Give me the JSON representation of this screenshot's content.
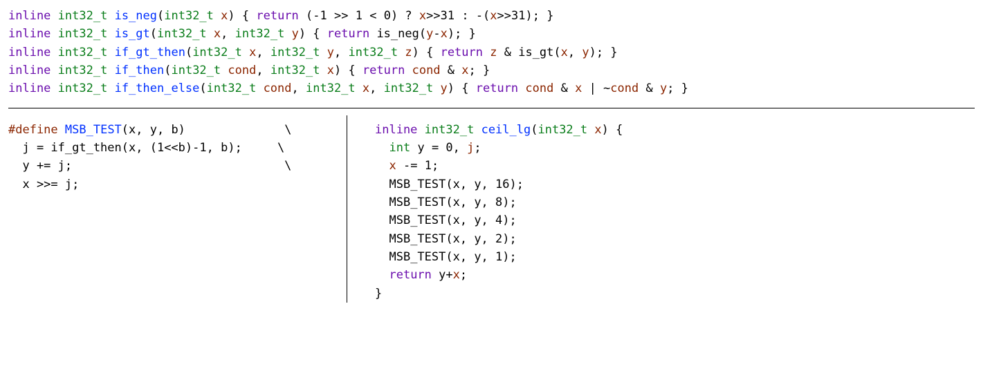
{
  "tokens": {
    "inline": "inline",
    "int32": "int32_t",
    "int": "int",
    "return": "return",
    "define": "#define"
  },
  "top": {
    "is_neg": {
      "name": "is_neg",
      "params": "x",
      "body_pre": "(-",
      "body_num1": "1",
      "body_mid1": " >> ",
      "body_num2": "1",
      "body_mid2": " < ",
      "body_num3": "0",
      "body_mid3": ") ? ",
      "body_var1": "x",
      "body_mid4": ">>",
      "body_num4": "31",
      "body_mid5": " : -(",
      "body_var2": "x",
      "body_mid6": ">>",
      "body_num5": "31",
      "body_end": ");"
    },
    "is_gt": {
      "name": "is_gt",
      "p1": "x",
      "p2": "y",
      "call": "is_neg",
      "arg_l": "(",
      "arg_y": "y",
      "arg_mid": "-",
      "arg_x": "x",
      "arg_r": ");"
    },
    "if_gt_then": {
      "name": "if_gt_then",
      "p1": "x",
      "p2": "y",
      "p3": "z",
      "ret_z": "z",
      "ret_amp": " & ",
      "call": "is_gt",
      "call_args_l": "(",
      "call_x": "x",
      "call_sep": ", ",
      "call_y": "y",
      "call_args_r": ");"
    },
    "if_then": {
      "name": "if_then",
      "p1": "cond",
      "p2": "x",
      "ret_cond": "cond",
      "ret_amp": " & ",
      "ret_x": "x",
      "ret_end": ";"
    },
    "if_then_else": {
      "name": "if_then_else",
      "p1": "cond",
      "p2": "x",
      "p3": "y",
      "ret_cond": "cond",
      "ret_amp": " & ",
      "ret_x": "x",
      "ret_or": " | ~",
      "ret_cond2": "cond",
      "ret_amp2": " & ",
      "ret_y": "y",
      "ret_end": ";"
    }
  },
  "left": {
    "macro": "MSB_TEST",
    "macro_args": "(x, y, b)",
    "l1_pre": "  j = if_gt_then(x, (",
    "l1_num1": "1",
    "l1_mid": "<<b)-",
    "l1_num2": "1",
    "l1_post": ", b);",
    "l2": "  y += j;",
    "l3": "  x >>= j;"
  },
  "right": {
    "fn": "ceil_lg",
    "p": "x",
    "decl_pre": "  ",
    "decl_y": "y",
    "decl_mid": " = ",
    "decl_num0": "0",
    "decl_post": ", ",
    "decl_j": "j",
    "decl_end": ";",
    "xdec_pre": "  ",
    "xdec_x": "x",
    "xdec_mid": " -= ",
    "xdec_num": "1",
    "xdec_end": ";",
    "calls": [
      {
        "args": "(x, y, ",
        "n": "16",
        "end": ");"
      },
      {
        "args": "(x, y, ",
        "n": "8",
        "end": ");"
      },
      {
        "args": "(x, y, ",
        "n": "4",
        "end": ");"
      },
      {
        "args": "(x, y, ",
        "n": "2",
        "end": ");"
      },
      {
        "args": "(x, y, ",
        "n": "1",
        "end": ");"
      }
    ],
    "ret_pre": "  ",
    "ret_y": "y",
    "ret_plus": "+",
    "ret_x": "x",
    "ret_end": ";"
  },
  "bslash": "\\"
}
